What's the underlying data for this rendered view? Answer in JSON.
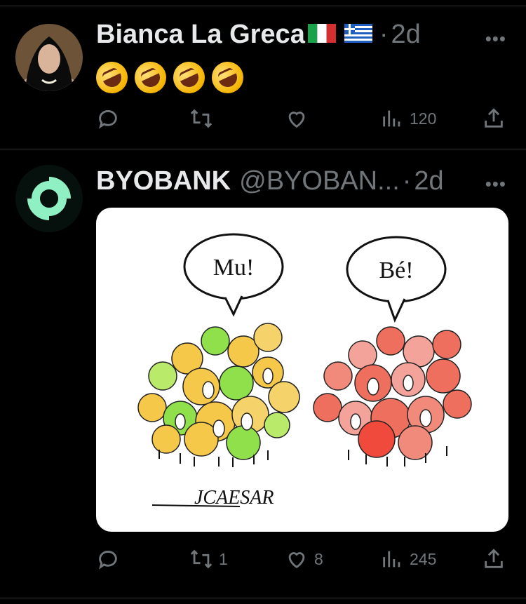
{
  "tweets": [
    {
      "author_name": "Bianca La Greca",
      "flags": [
        "italy-flag",
        "greece-flag"
      ],
      "dot": "·",
      "time": "2d",
      "more": "•••",
      "content_emojis": [
        "rolling-on-floor-laughing",
        "rolling-on-floor-laughing",
        "rolling-on-floor-laughing",
        "rolling-on-floor-laughing"
      ],
      "actions": {
        "reply_count": "",
        "retweet_count": "",
        "like_count": "",
        "views_count": "120"
      }
    },
    {
      "author_name": "BYOBANK",
      "handle": "@BYOBAN...",
      "dot": "·",
      "time": "2d",
      "more": "•••",
      "image": {
        "bubble_left": "Mu!",
        "bubble_right": "Bé!",
        "signature": "JCAESAR"
      },
      "actions": {
        "reply_count": "",
        "retweet_count": "1",
        "like_count": "8",
        "views_count": "245"
      }
    }
  ],
  "colors": {
    "background": "#000000",
    "text": "#e7e9ea",
    "muted": "#71767b",
    "divider": "#2f3336",
    "byobank_logo": "#8ff0c4"
  }
}
